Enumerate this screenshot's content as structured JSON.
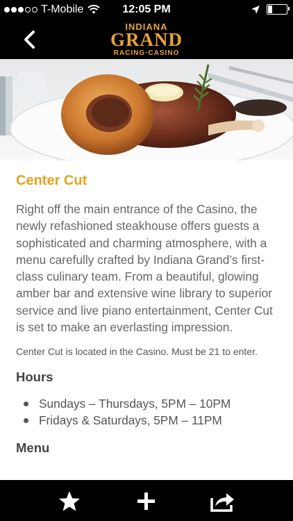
{
  "status_bar": {
    "carrier": "T-Mobile",
    "time": "12:05 PM",
    "signal_bars": 3,
    "battery_level": 0.2,
    "icons": [
      "wifi-icon",
      "location-arrow-icon",
      "battery-icon"
    ]
  },
  "header": {
    "back_icon": "chevron-left-icon",
    "logo": {
      "line1": "INDIANA",
      "line2": "GRAND",
      "line3": "RACING·CASINO",
      "color": "#e9a43a"
    }
  },
  "hero": {
    "description_icon": "steak-dish-image"
  },
  "venue": {
    "title": "Center Cut",
    "description": "Right off the main entrance of the Casino, the newly refashioned steakhouse offers guests a sophisticated and charming atmosphere, with a menu carefully crafted by Indiana Grand’s first-class culinary team. From a beautiful, glowing amber bar and extensive wine library to superior service and live piano entertainment, Center Cut is set to make an everlasting impression.",
    "note": "Center Cut is located in the Casino. Must be 21 to enter.",
    "hours_heading": "Hours",
    "hours": [
      "Sundays – Thursdays, 5PM – 10PM",
      "Fridays & Saturdays, 5PM – 11PM"
    ],
    "menu_heading": "Menu"
  },
  "tab_bar": {
    "items": [
      "star-icon",
      "plus-icon",
      "share-icon"
    ]
  },
  "colors": {
    "accent": "#e8a21e",
    "bars": "#000000",
    "body_text": "#666666"
  }
}
